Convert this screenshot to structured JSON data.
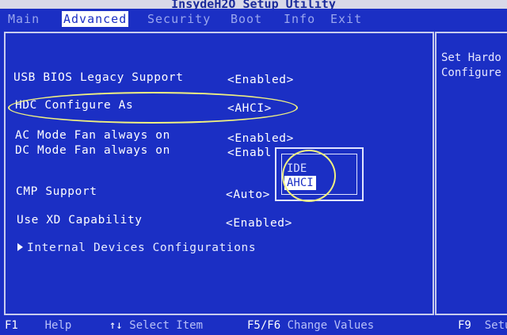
{
  "app_title": "InsydeH2O Setup Utility",
  "menu": [
    "Main",
    "Advanced",
    "Security",
    "Boot",
    "Info",
    "Exit"
  ],
  "active_menu": "Advanced",
  "settings": [
    {
      "label": "USB BIOS Legacy Support",
      "value": "<Enabled>"
    },
    {
      "label": "HDC Configure As",
      "value": "<AHCI>"
    },
    {
      "label": "AC Mode Fan always on",
      "value": "<Enabled>"
    },
    {
      "label": "DC Mode Fan always on",
      "value": "<Enabl"
    },
    {
      "label": "CMP Support",
      "value": "<Auto>"
    },
    {
      "label": "Use XD Capability",
      "value": "<Enabled>"
    }
  ],
  "submenu": "Internal Devices Configurations",
  "help": {
    "line1": "Set Hardo",
    "line2": "Configure"
  },
  "popup": {
    "options": [
      "IDE",
      "AHCI"
    ],
    "selected": "AHCI"
  },
  "footer": [
    {
      "key": "F1",
      "action": "Help"
    },
    {
      "key": "↑↓",
      "action": "Select Item"
    },
    {
      "key": "F5/F6",
      "action": "Change Values"
    },
    {
      "key": "F9",
      "action": "Setu"
    }
  ],
  "colors": {
    "background": "#1b2fc4",
    "highlight": "#f0f080",
    "text": "#ffffff"
  }
}
